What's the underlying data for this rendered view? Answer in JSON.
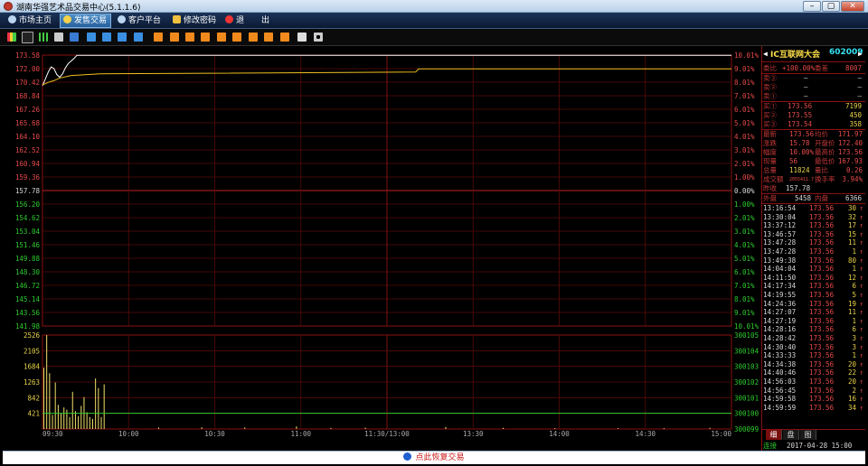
{
  "window": {
    "title": "湖南华强艺术品交易中心(5.1.1.6)",
    "min_label": "–",
    "max_label": "▢",
    "close_label": "✕"
  },
  "menu": {
    "items": [
      {
        "label": "市场主页",
        "icon": "globe-icon"
      },
      {
        "label": "发售交易",
        "icon": "yen-icon",
        "active": true
      },
      {
        "label": "客户平台",
        "icon": "globe-icon"
      },
      {
        "label": "修改密码",
        "icon": "key-icon"
      },
      {
        "label": "退",
        "icon": "exit-icon"
      },
      {
        "label": "出",
        "icon": ""
      }
    ]
  },
  "toolbar": {
    "icons": [
      "bar-chart-icon",
      "line-chart-icon",
      "candles-icon",
      "calendar-icon",
      "list-icon",
      "info-icon",
      "news-icon",
      "grid-icon",
      "quote-icon",
      "sort-icon",
      "one-icon",
      "two-icon",
      "three-icon",
      "four-icon",
      "five-icon",
      "six-icon",
      "seven-icon",
      "eight-icon",
      "nine-icon",
      "draw-icon",
      "settings-icon"
    ]
  },
  "chart_data": {
    "type": "line",
    "prev_close": 157.78,
    "price_axis_left": [
      "173.58",
      "172.00",
      "170.42",
      "168.84",
      "167.26",
      "165.68",
      "164.10",
      "162.52",
      "160.94",
      "159.36",
      "157.78",
      "156.20",
      "154.62",
      "153.04",
      "151.46",
      "149.88",
      "148.30",
      "146.72",
      "145.14",
      "143.56",
      "141.98"
    ],
    "price_axis_right": [
      "10.01%",
      "9.01%",
      "8.01%",
      "7.01%",
      "6.01%",
      "5.01%",
      "4.01%",
      "3.01%",
      "2.01%",
      "1.00%",
      "0.00%",
      "1.00%",
      "2.01%",
      "3.01%",
      "4.01%",
      "5.01%",
      "6.01%",
      "7.01%",
      "8.01%",
      "9.01%",
      "10.01%"
    ],
    "ylim": [
      141.98,
      173.58
    ],
    "volume_axis_left": [
      "2526",
      "2105",
      "1684",
      "1263",
      "842",
      "421"
    ],
    "volume_axis_right": [
      "300105",
      "300104",
      "300103",
      "300102",
      "300101",
      "300100",
      "300099"
    ],
    "time_labels": [
      "09:30",
      "10:00",
      "10:30",
      "11:00",
      "11:30/13:00",
      "13:30",
      "14:00",
      "14:30",
      "15:00"
    ],
    "total_minutes": 240,
    "series": [
      {
        "kind": "price",
        "color": "#ffffff",
        "points": [
          [
            0,
            170.0
          ],
          [
            1,
            170.8
          ],
          [
            2,
            171.6
          ],
          [
            3,
            172.2
          ],
          [
            4,
            172.0
          ],
          [
            5,
            171.3
          ],
          [
            6,
            171.0
          ],
          [
            7,
            171.4
          ],
          [
            8,
            172.1
          ],
          [
            9,
            172.6
          ],
          [
            10,
            172.9
          ],
          [
            11,
            173.2
          ],
          [
            12,
            173.56
          ],
          [
            240,
            173.56
          ]
        ]
      },
      {
        "kind": "average",
        "color": "#f0c020",
        "points": [
          [
            0,
            170.1
          ],
          [
            2,
            170.4
          ],
          [
            4,
            170.6
          ],
          [
            6,
            170.9
          ],
          [
            10,
            171.2
          ],
          [
            20,
            171.4
          ],
          [
            50,
            171.45
          ],
          [
            130,
            171.6
          ],
          [
            131,
            171.97
          ],
          [
            240,
            171.97
          ]
        ]
      },
      {
        "kind": "volume",
        "color": "#f0e068",
        "points": [
          [
            0,
            1650
          ],
          [
            1,
            2526
          ],
          [
            2,
            1500
          ],
          [
            3,
            380
          ],
          [
            4,
            1250
          ],
          [
            5,
            650
          ],
          [
            6,
            420
          ],
          [
            7,
            580
          ],
          [
            8,
            520
          ],
          [
            9,
            320
          ],
          [
            10,
            1000
          ],
          [
            11,
            480
          ],
          [
            12,
            340
          ],
          [
            13,
            620
          ],
          [
            14,
            860
          ],
          [
            15,
            450
          ],
          [
            16,
            320
          ],
          [
            17,
            270
          ],
          [
            18,
            1360
          ],
          [
            19,
            1100
          ],
          [
            20,
            320
          ],
          [
            21,
            1200
          ],
          [
            40,
            35
          ],
          [
            55,
            45
          ],
          [
            70,
            40
          ],
          [
            88,
            70
          ],
          [
            100,
            30
          ],
          [
            112,
            35
          ],
          [
            140,
            55
          ],
          [
            160,
            30
          ],
          [
            178,
            25
          ],
          [
            200,
            20
          ],
          [
            216,
            25
          ],
          [
            232,
            30
          ]
        ]
      },
      {
        "kind": "hold",
        "color": "#2ecc2e",
        "points": [
          [
            0,
            300100
          ],
          [
            240,
            300100
          ]
        ]
      }
    ]
  },
  "quote": {
    "name": "IC互联网大会",
    "code": "602009",
    "weibi_label": "委比",
    "weibi_value": "+100.00%",
    "weicha_label": "委差",
    "weicha_value": "8007",
    "sells": [
      {
        "label": "卖③",
        "price": "—",
        "vol": "—"
      },
      {
        "label": "卖②",
        "price": "—",
        "vol": "—"
      },
      {
        "label": "卖①",
        "price": "—",
        "vol": "—"
      }
    ],
    "buys": [
      {
        "label": "买①",
        "price": "173.56",
        "vol": "7199"
      },
      {
        "label": "买②",
        "price": "173.55",
        "vol": "450"
      },
      {
        "label": "买③",
        "price": "173.54",
        "vol": "358"
      }
    ],
    "stats": [
      {
        "l1": "最新",
        "v1": "173.56",
        "l2": "均价",
        "v2": "171.97"
      },
      {
        "l1": "涨跌",
        "v1": "15.78",
        "l2": "开盘价",
        "v2": "172.40"
      },
      {
        "l1": "幅度",
        "v1": "10.00%",
        "l2": "最高价",
        "v2": "173.56"
      },
      {
        "l1": "现量",
        "v1": "56",
        "l2": "最低价",
        "v2": "167.93"
      },
      {
        "l1": "总量",
        "v1": "11824",
        "l2": "量比",
        "v2": "0.26"
      },
      {
        "l1": "成交额",
        "v1": "2055411.7",
        "l2": "换手率",
        "v2": "3.94%"
      }
    ],
    "prev_label": "昨收",
    "prev_value": "157.78",
    "outer_label": "外盘",
    "outer_value": "5458",
    "inner_label": "内盘",
    "inner_value": "6366",
    "ticks": [
      {
        "time": "13:16:54",
        "price": "173.56",
        "vol": "30"
      },
      {
        "time": "13:30:04",
        "price": "173.56",
        "vol": "32"
      },
      {
        "time": "13:37:12",
        "price": "173.56",
        "vol": "17"
      },
      {
        "time": "13:46:57",
        "price": "173.56",
        "vol": "15"
      },
      {
        "time": "13:47:28",
        "price": "173.56",
        "vol": "11"
      },
      {
        "time": "13:47:28",
        "price": "173.56",
        "vol": "1"
      },
      {
        "time": "13:49:38",
        "price": "173.56",
        "vol": "80"
      },
      {
        "time": "14:04:04",
        "price": "173.56",
        "vol": "1"
      },
      {
        "time": "14:11:50",
        "price": "173.56",
        "vol": "12"
      },
      {
        "time": "14:17:34",
        "price": "173.56",
        "vol": "6"
      },
      {
        "time": "14:19:55",
        "price": "173.56",
        "vol": "5"
      },
      {
        "time": "14:24:36",
        "price": "173.56",
        "vol": "19"
      },
      {
        "time": "14:27:07",
        "price": "173.56",
        "vol": "11"
      },
      {
        "time": "14:27:19",
        "price": "173.56",
        "vol": "1"
      },
      {
        "time": "14:28:16",
        "price": "173.56",
        "vol": "6"
      },
      {
        "time": "14:28:42",
        "price": "173.56",
        "vol": "3"
      },
      {
        "time": "14:30:40",
        "price": "173.56",
        "vol": "3"
      },
      {
        "time": "14:33:33",
        "price": "173.56",
        "vol": "1"
      },
      {
        "time": "14:34:38",
        "price": "173.56",
        "vol": "20"
      },
      {
        "time": "14:40:46",
        "price": "173.56",
        "vol": "22"
      },
      {
        "time": "14:56:03",
        "price": "173.56",
        "vol": "20"
      },
      {
        "time": "14:56:45",
        "price": "173.56",
        "vol": "2"
      },
      {
        "time": "14:59:58",
        "price": "173.56",
        "vol": "16"
      },
      {
        "time": "14:59:59",
        "price": "173.56",
        "vol": "34"
      }
    ],
    "tick_arrow": "↑",
    "tabs": [
      "细",
      "盘",
      "图"
    ],
    "status_conn": "连接",
    "status_time": "2017-04-28 15:00"
  },
  "notice": {
    "text": "点此恢复交易"
  }
}
